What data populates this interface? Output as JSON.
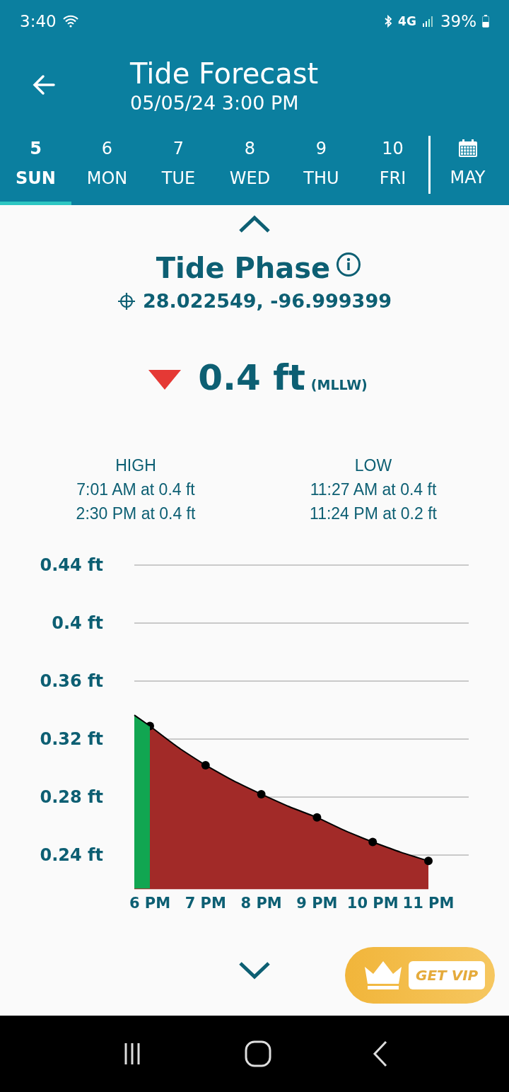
{
  "status_bar": {
    "time": "3:40",
    "network": "4G",
    "battery": "39%"
  },
  "header": {
    "title": "Tide Forecast",
    "subtitle": "05/05/24 3:00 PM"
  },
  "day_tabs": [
    {
      "day": "5",
      "weekday": "SUN",
      "selected": true
    },
    {
      "day": "6",
      "weekday": "MON",
      "selected": false
    },
    {
      "day": "7",
      "weekday": "TUE",
      "selected": false
    },
    {
      "day": "8",
      "weekday": "WED",
      "selected": false
    },
    {
      "day": "9",
      "weekday": "THU",
      "selected": false
    },
    {
      "day": "10",
      "weekday": "FRI",
      "selected": false
    }
  ],
  "month_tab": {
    "label": "MAY"
  },
  "phase": {
    "title": "Tide Phase",
    "coordinates": "28.022549, -96.999399",
    "falling": true,
    "height": "0.4 ft",
    "datum": "(MLLW)"
  },
  "extremes": [
    {
      "label": "HIGH",
      "times": [
        "7:01 AM at 0.4 ft",
        "2:30 PM at 0.4 ft"
      ]
    },
    {
      "label": "LOW",
      "times": [
        "11:27 AM at 0.4 ft",
        "11:24 PM at 0.2 ft"
      ]
    }
  ],
  "chart_data": {
    "type": "area",
    "categories": [
      "6 PM",
      "7 PM",
      "8 PM",
      "9 PM",
      "10 PM",
      "11 PM"
    ],
    "series": [
      {
        "color": "#a22a28",
        "values": [
          0.329,
          0.302,
          0.282,
          0.266,
          0.249,
          0.236
        ]
      }
    ],
    "grid": true,
    "ylim": [
      0.217,
      0.44
    ],
    "yticks": [
      {
        "value": 0.44,
        "label": "0.44 ft"
      },
      {
        "value": 0.4,
        "label": "0.4 ft"
      },
      {
        "value": 0.36,
        "label": "0.36 ft"
      },
      {
        "value": 0.32,
        "label": "0.32 ft"
      },
      {
        "value": 0.28,
        "label": "0.28 ft"
      },
      {
        "value": 0.24,
        "label": "0.24 ft"
      }
    ]
  },
  "vip_button": {
    "label": "GET VIP"
  }
}
